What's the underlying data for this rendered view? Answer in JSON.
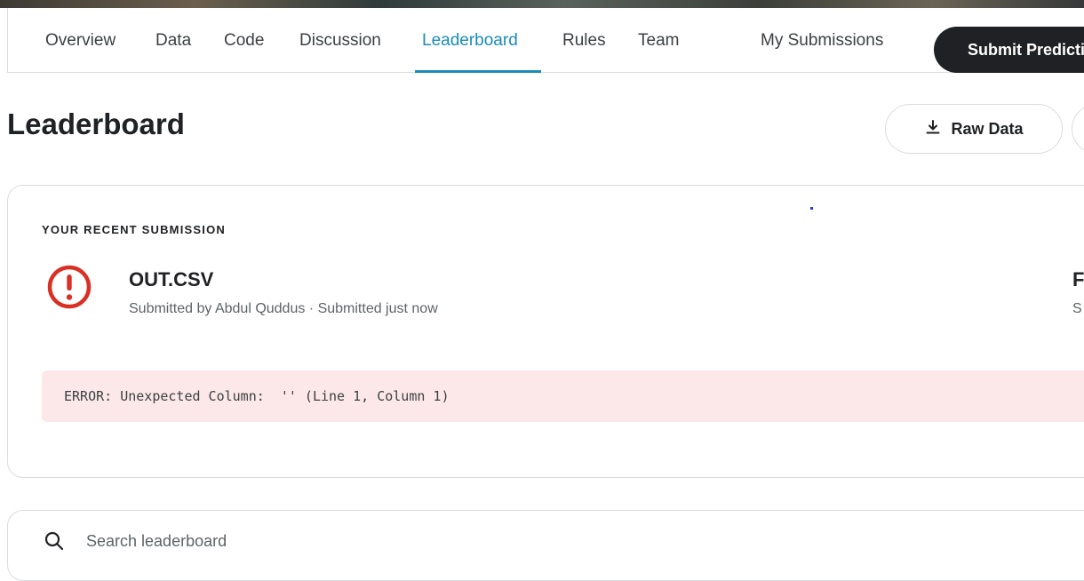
{
  "nav": {
    "tabs": [
      {
        "label": "Overview"
      },
      {
        "label": "Data"
      },
      {
        "label": "Code"
      },
      {
        "label": "Discussion"
      },
      {
        "label": "Leaderboard",
        "active": true
      },
      {
        "label": "Rules"
      },
      {
        "label": "Team"
      }
    ],
    "my_submissions": "My Submissions",
    "submit_button": "Submit Prediction"
  },
  "header": {
    "title": "Leaderboard",
    "raw_data_label": "Raw Data"
  },
  "recent_submission": {
    "section_label": "YOUR RECENT SUBMISSION",
    "status_icon": "error-icon",
    "file_name": "OUT.CSV",
    "meta": "Submitted by Abdul Quddus · Submitted just now",
    "right_title": "F",
    "right_sub": "S",
    "error_message": "ERROR: Unexpected Column:  '' (Line 1, Column 1)"
  },
  "search": {
    "placeholder": "Search leaderboard"
  },
  "colors": {
    "accent": "#1a8bb9",
    "error": "#d93025",
    "error_bg": "#fce8e8",
    "dark_button": "#202124"
  }
}
